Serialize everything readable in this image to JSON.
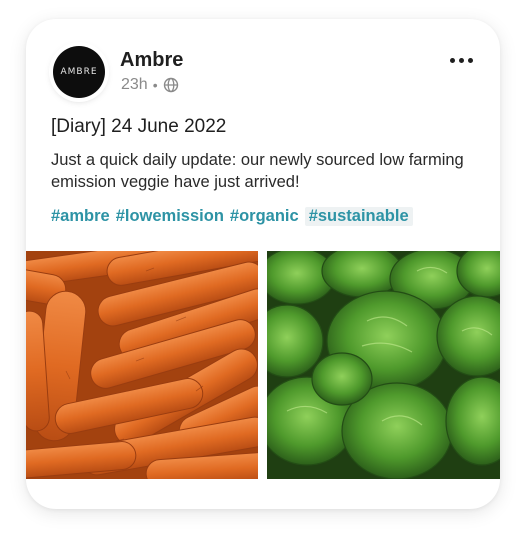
{
  "post": {
    "author": {
      "name": "Ambre",
      "avatar_text": "AMBRE",
      "avatar_color": "#0d0d0d"
    },
    "time": "23h",
    "separator": "•",
    "visibility_icon": "globe-icon",
    "more_icon": "more-horizontal-icon",
    "title": "[Diary] 24 June 2022",
    "body": "Just a quick daily update: our newly sourced low farming emission veggie have just arrived!",
    "hashtags": [
      "#ambre",
      "#lowemission",
      "#organic",
      "#sustainable"
    ],
    "hashtag_color": "#2d93a5",
    "images": [
      {
        "subject": "carrots"
      },
      {
        "subject": "lettuce"
      }
    ]
  }
}
